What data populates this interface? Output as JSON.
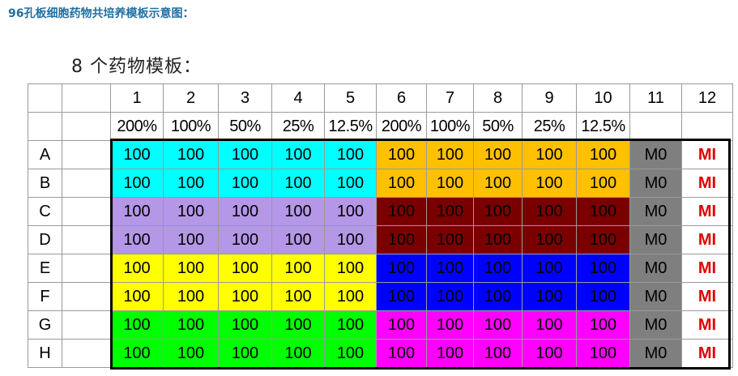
{
  "heading": "96孔板细胞药物共培养模板示意图：",
  "subtitle": "8 个药物模板：",
  "columns": [
    "1",
    "2",
    "3",
    "4",
    "5",
    "6",
    "7",
    "8",
    "9",
    "10",
    "11",
    "12"
  ],
  "concentrations": [
    "200%",
    "100%",
    "50%",
    "25%",
    "12.5%",
    "200%",
    "100%",
    "50%",
    "25%",
    "12.5%",
    "",
    ""
  ],
  "rows": [
    "A",
    "B",
    "C",
    "D",
    "E",
    "F",
    "G",
    "H"
  ],
  "value": "100",
  "col11_label": "M0",
  "col12_label": "MI",
  "colors": {
    "cyan": "#00ffff",
    "orange": "#ffc000",
    "lavender": "#b497e6",
    "maroon": "#7a0000",
    "yellow": "#ffff00",
    "blue": "#0000ff",
    "green": "#00ff00",
    "magenta": "#ff00ff",
    "gray": "#7f7f7f",
    "mi_text": "#e00000"
  },
  "row_groups": [
    {
      "left": "cyan",
      "right": "orange"
    },
    {
      "left": "cyan",
      "right": "orange"
    },
    {
      "left": "lavender",
      "right": "maroon"
    },
    {
      "left": "lavender",
      "right": "maroon"
    },
    {
      "left": "yellow",
      "right": "blue"
    },
    {
      "left": "yellow",
      "right": "blue"
    },
    {
      "left": "green",
      "right": "magenta"
    },
    {
      "left": "green",
      "right": "magenta"
    }
  ]
}
